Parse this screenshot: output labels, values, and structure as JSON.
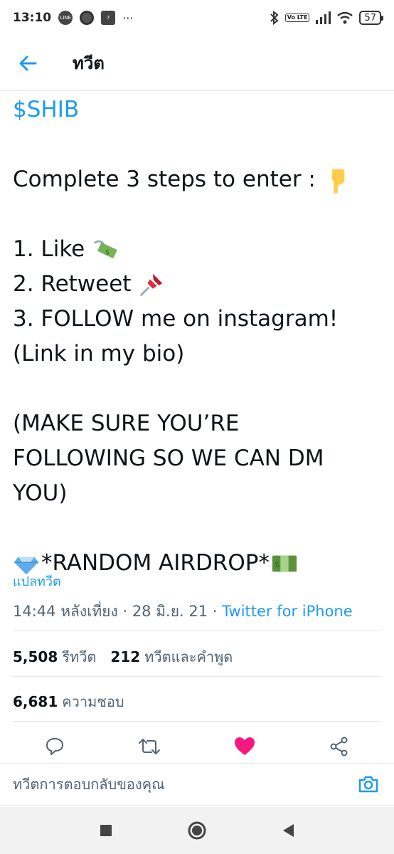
{
  "status_bar": {
    "time": "13:10",
    "more": "···",
    "battery": "57",
    "volte": "Vo LTE"
  },
  "header": {
    "title": "ทวีต"
  },
  "tweet": {
    "cashtag": "$SHIB",
    "lines": {
      "steps_intro": "Complete 3 steps to enter :",
      "step1": "1. Like",
      "step2": "2. Retweet",
      "step3": "3. FOLLOW me on instagram!",
      "bio": "(Link in my bio)",
      "make_sure1": "(MAKE SURE YOU’RE",
      "make_sure2": "FOLLOWING SO WE CAN DM",
      "make_sure3": "YOU)",
      "airdrop": "*RANDOM AIRDROP*"
    },
    "translate": "แปลทวีต",
    "time": "14:44 หลังเที่ยง",
    "date": "28 มิ.ย. 21",
    "source": "Twitter for iPhone",
    "sep": "·"
  },
  "stats": {
    "retweets_count": "5,508",
    "retweets_label": "รีทวีต",
    "quotes_count": "212",
    "quotes_label": "ทวีตและคำพูด",
    "likes_count": "6,681",
    "likes_label": "ความชอบ"
  },
  "actions": {
    "liked": true,
    "like_color": "#f91880",
    "accent": "#1d9bf0"
  },
  "reply": {
    "placeholder": "ทวีตการตอบกลับของคุณ"
  }
}
